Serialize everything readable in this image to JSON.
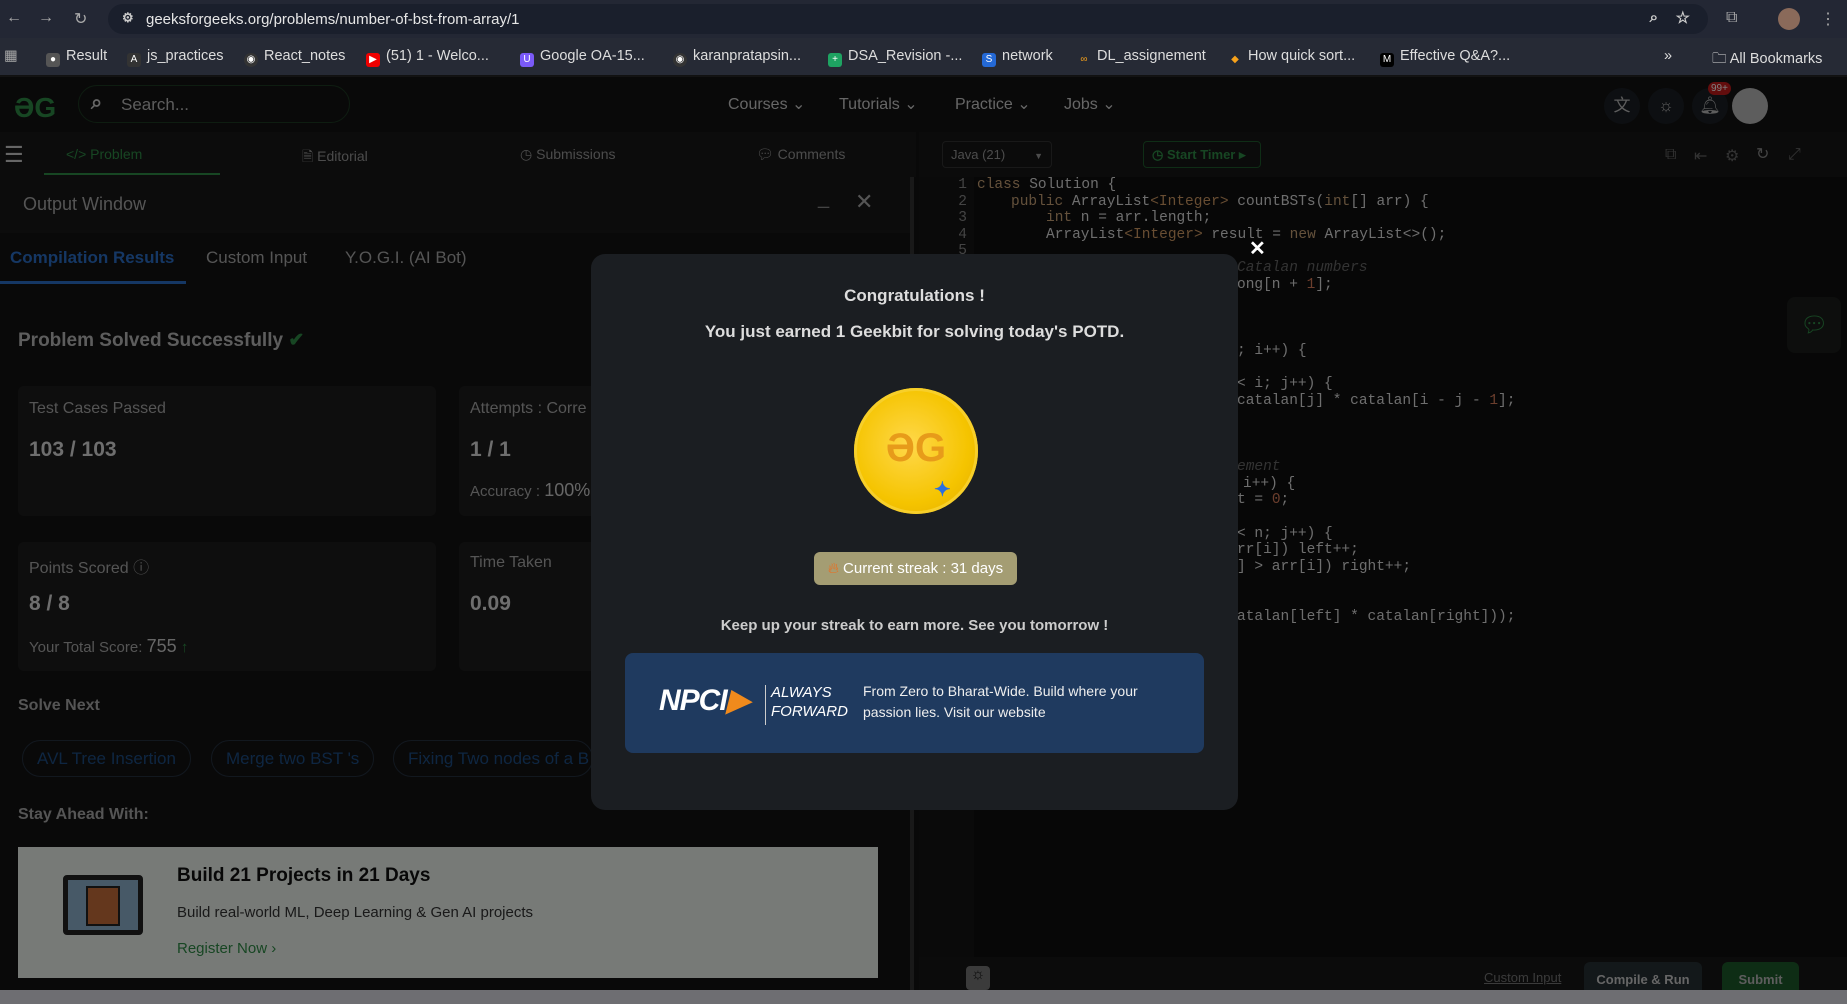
{
  "browser": {
    "url": "geeksforgeeks.org/problems/number-of-bst-from-array/1",
    "bookmarks": [
      "Result",
      "js_practices",
      "React_notes",
      "(51) 1 - Welco...",
      "Google OA-15...",
      "karanpratapsin...",
      "DSA_Revision -...",
      "network",
      "DL_assignement",
      "How quick sort...",
      "Effective Q&A?..."
    ],
    "bookmark_colors": [
      "#555",
      "#333",
      "#333",
      "#e00",
      "#7a5af8",
      "#333",
      "#1ea362",
      "#2469d6",
      "#f7a21b",
      "#555",
      "#000"
    ],
    "all_bookmarks": "All Bookmarks",
    "more": "»"
  },
  "header": {
    "logo": "ƏG",
    "search_placeholder": "Search...",
    "nav": [
      "Courses",
      "Tutorials",
      "Practice",
      "Jobs"
    ],
    "notif_badge": "99+"
  },
  "problem_tabs": [
    "Problem",
    "Editorial",
    "Submissions",
    "Comments"
  ],
  "output": {
    "title": "Output Window",
    "tabs": [
      "Compilation Results",
      "Custom Input",
      "Y.O.G.I. (AI Bot)"
    ],
    "status": "Problem Solved Successfully",
    "test_cases_label": "Test Cases Passed",
    "test_cases_value": "103 / 103",
    "attempts_label": "Attempts : Corre",
    "attempts_value": "1 / 1",
    "accuracy_label": "Accuracy :",
    "accuracy_value": "100%",
    "points_label": "Points Scored",
    "points_value": "8 / 8",
    "total_score_label": "Your Total Score:",
    "total_score_value": "755",
    "time_label": "Time Taken",
    "time_value": "0.09",
    "solve_next_label": "Solve Next",
    "solve_next": [
      "AVL Tree Insertion",
      "Merge two BST 's",
      "Fixing Two nodes of a B"
    ],
    "stay_ahead_label": "Stay Ahead With:",
    "promo": {
      "title": "Build 21 Projects in 21 Days",
      "desc": "Build real-world ML, Deep Learning & Gen AI projects",
      "cta": "Register Now"
    }
  },
  "editor": {
    "language": "Java (21)",
    "timer": "Start Timer",
    "custom_input": "Custom Input",
    "compile_run": "Compile & Run",
    "submit": "Submit",
    "line_numbers": [
      "1",
      "2",
      "3",
      "4",
      "5"
    ]
  },
  "modal": {
    "title": "Congratulations !",
    "subtitle": "You just earned 1 Geekbit for solving today's POTD.",
    "streak": "Current streak : 31 days",
    "footer": "Keep up your streak to earn more. See you tomorrow !",
    "ad": {
      "logo": "NPCI",
      "tagline1": "ALWAYS",
      "tagline2": "FORWARD",
      "text": "From Zero to Bharat-Wide. Build where your passion lies. Visit our website"
    },
    "close": "✕"
  }
}
